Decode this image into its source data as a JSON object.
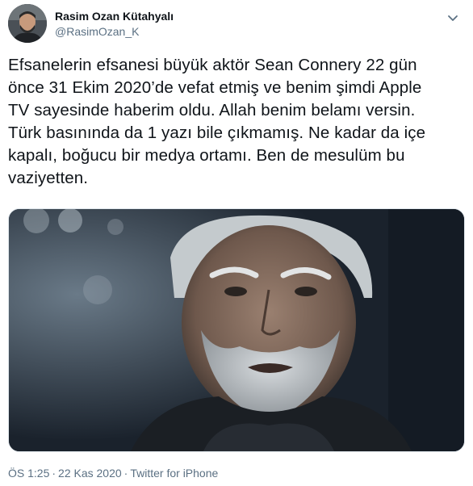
{
  "author": {
    "name": "Rasim Ozan Kütahyalı",
    "handle": "@RasimOzan_K"
  },
  "tweet": {
    "text": "Efsanelerin efsanesi büyük aktör Sean Connery 22 gün\nönce 31 Ekim 2020’de vefat etmiş ve benim şimdi Apple\nTV sayesinde haberim oldu. Allah benim belamı versin.\nTürk basınında da 1 yazı bile çıkmamış. Ne kadar da içe\nkapalı, boğucu bir medya ortamı. Ben de mesulüm bu\nvaziyetten."
  },
  "meta": {
    "time": "ÖS 1:25",
    "separator": "·",
    "date": "22 Kas 2020",
    "source": "Twitter for iPhone"
  },
  "icons": {
    "more": "chevron-down-icon"
  },
  "colors": {
    "text": "#0f1419",
    "secondary": "#5b7083",
    "border": "#e1e8ed"
  }
}
